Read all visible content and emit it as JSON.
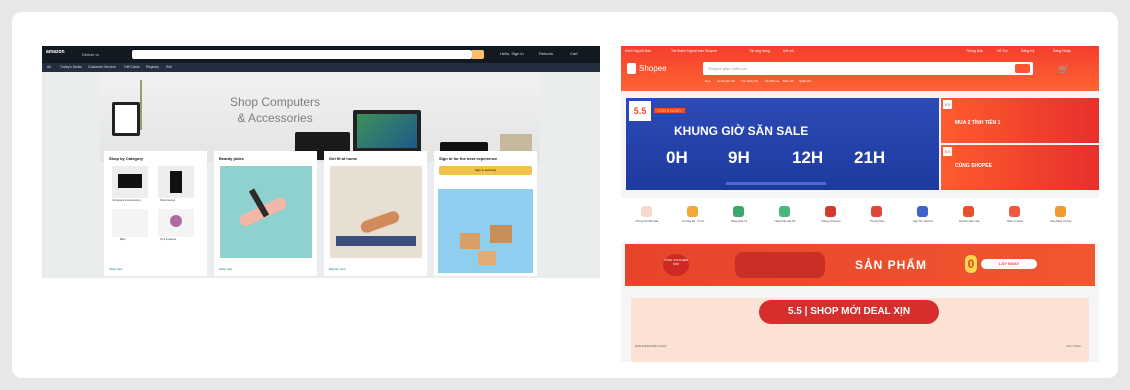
{
  "amazon": {
    "logo": "amazon",
    "deliver": "Deliver to",
    "account_items": [
      "Hello, Sign in",
      "Returns",
      "Cart"
    ],
    "nav_items": [
      "All",
      "Today's Deals",
      "Customer Service",
      "Gift Cards",
      "Registry",
      "Sell"
    ],
    "hero_title": "Shop Computers\n& Accessories",
    "cards": [
      {
        "title": "Shop by Category",
        "thumb_labels": [
          "Computers & Accessories",
          "Video Games",
          "Baby",
          "Toys & Games"
        ],
        "footer": "Shop now"
      },
      {
        "title": "Beauty picks",
        "footer": "Shop now"
      },
      {
        "title": "Get fit at home",
        "footer": "Explore now"
      },
      {
        "title": "Sign in for the best experience",
        "button": "Sign in securely"
      }
    ],
    "colors": {
      "topbar": "#131921",
      "navbar": "#232f3e",
      "search_button": "#febd69"
    }
  },
  "shopee": {
    "top_links": [
      "Kênh Người Bán",
      "Trở thành Người bán Shopee",
      "Tải ứng dụng",
      "Kết nối"
    ],
    "top_right": [
      "Thông Báo",
      "Hỗ Trợ",
      "Đăng Ký",
      "Đăng Nhập"
    ],
    "logo": "Shopee",
    "search_placeholder": "Shopee giao miễn phí",
    "search_hints": [
      "Dép",
      "Áo Khoác Nữ",
      "Túi Xách Nữ",
      "Ốp iPhone",
      "Balo Nữ",
      "Quần Nữ"
    ],
    "banner": {
      "badge": "5.5",
      "subtitle": "CÒN 5 NGÀY",
      "title": "KHUNG GIỜ SĂN SALE",
      "times": [
        "0H",
        "9H",
        "12H",
        "21H"
      ]
    },
    "side_banners": [
      {
        "badge": "5.5",
        "title": "MUA 2 TÍNH TIỀN 1"
      },
      {
        "badge": "5.5",
        "title": "CÙNG SHOPEE"
      }
    ],
    "categories": [
      "Khung Giờ Săn Sale",
      "Gì Cũng Rẻ - Từ 1K",
      "Hàng Quốc Tế",
      "Hàng Hiệu Giá Tốt",
      "Shopee Premium",
      "Thương Hiệu",
      "Nạp Thẻ, Dịch Vụ",
      "Voucher Giảm Giá",
      "Hoàn Xu Extra",
      "Mua Hàng Trả Sau"
    ],
    "promo": {
      "badge": "TẶNG VOUCHER MỚI",
      "title": "SẢN PHẨM",
      "zero": "0",
      "button": "LẤY NGAY"
    },
    "deal": {
      "ribbon": "5.5 | SHOP MỚI DEAL XỊN",
      "sub": "SẢN PHẨM BÁN CHẠY",
      "more": "Xem Thêm"
    },
    "colors": {
      "header": "#f53d2d",
      "banner": "#2c4bb7",
      "accent": "#ee4d2d",
      "deal_bg": "#fbe2d5"
    }
  }
}
